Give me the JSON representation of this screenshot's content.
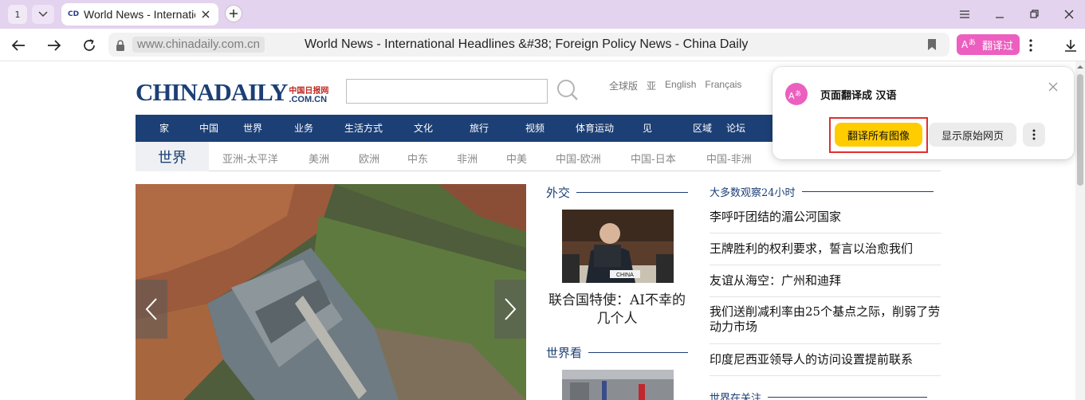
{
  "browser": {
    "tab_count": "1",
    "tab": {
      "title": "World News - International Headlines & Foreign Policy News - China Daily",
      "favicon": "CD"
    },
    "address": {
      "host": "www.chinadaily.com.cn",
      "page_title": "World News - International Headlines &#38; Foreign Policy News - China Daily"
    },
    "translated_label": "翻译过"
  },
  "site": {
    "logo_main": "CHINADAILY",
    "logo_cn": "中国日报网",
    "logo_com": ".COM.CN",
    "editions": [
      "全球版",
      "亚",
      "English",
      "Français"
    ],
    "main_nav": [
      "家",
      "中国",
      "世界",
      "业务",
      "生活方式",
      "文化",
      "旅行",
      "视频",
      "体育运动",
      "见",
      "区域",
      "论坛"
    ],
    "section_current": "世界",
    "sub_nav": [
      "亚洲-太平洋",
      "美洲",
      "欧洲",
      "中东",
      "非洲",
      "中美",
      "中国-欧洲",
      "中国-日本",
      "中国-非洲"
    ]
  },
  "content": {
    "diplomacy": {
      "heading": "外交",
      "photo_label": "CHINA",
      "caption": "联合国特使：AI不幸的几个人"
    },
    "world_watch": {
      "heading": "世界看"
    },
    "most_viewed": {
      "heading": "大多数观察24小时",
      "items": [
        "李呼吁团结的湄公河国家",
        "王牌胜利的权利要求，誓言以治愈我们",
        "友谊从海空：广州和迪拜",
        "我们送削减利率由25个基点之际，削弱了劳动力市场",
        "印度尼西亚领导人的访问设置提前联系"
      ]
    },
    "world_focus": {
      "heading": "世界在关注"
    }
  },
  "translate_popup": {
    "title": "页面翻译成 汉语",
    "translate_images": "翻译所有图像",
    "show_original": "显示原始网页"
  },
  "colors": {
    "tabbar": "#e3d3ee",
    "brand_navy": "#1c3f75",
    "translate_pink": "#ec5fc0",
    "primary_yellow": "#ffcc00",
    "highlight_red": "#e32d2d"
  }
}
